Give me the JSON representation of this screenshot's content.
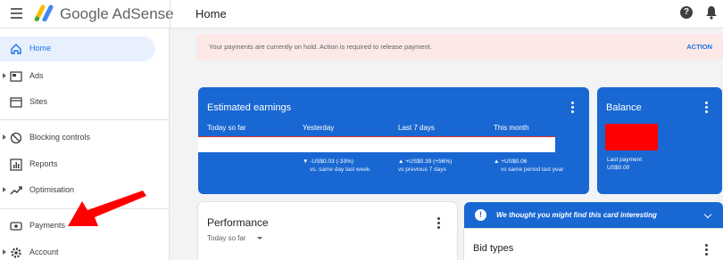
{
  "header": {
    "app_title": "Google AdSense",
    "page_title": "Home",
    "help_icon": "help-icon",
    "notification_icon": "bell-icon"
  },
  "sidebar": {
    "items": [
      {
        "label": "Home",
        "icon": "home-icon",
        "active": true
      },
      {
        "label": "Ads",
        "icon": "ads-icon",
        "expandable": true
      },
      {
        "label": "Sites",
        "icon": "sites-icon"
      },
      {
        "label": "Blocking controls",
        "icon": "block-icon",
        "expandable": true
      },
      {
        "label": "Reports",
        "icon": "reports-icon"
      },
      {
        "label": "Optimisation",
        "icon": "trending-icon",
        "expandable": true
      },
      {
        "label": "Payments",
        "icon": "payments-icon"
      },
      {
        "label": "Account",
        "icon": "gear-icon",
        "expandable": true
      }
    ]
  },
  "alert": {
    "message": "Your payments are currently on hold. Action is required to release payment.",
    "action": "ACTION"
  },
  "earnings": {
    "title": "Estimated earnings",
    "columns": [
      {
        "label": "Today so far",
        "delta": "",
        "sub": ""
      },
      {
        "label": "Yesterday",
        "delta": "▼ -US$0.03 (-33%)",
        "sub": "vs. same day last week"
      },
      {
        "label": "Last 7 days",
        "delta": "▲ +US$0.39 (+56%)",
        "sub": "vs previous 7 days"
      },
      {
        "label": "This month",
        "delta": "▲ +US$0.06",
        "sub": "vs same period last year"
      }
    ]
  },
  "balance": {
    "title": "Balance",
    "last_payment_label": "Last payment",
    "last_payment_value": "US$0.00"
  },
  "performance": {
    "title": "Performance",
    "range": "Today so far"
  },
  "suggestion": {
    "text": "We thought you might find this card interesting"
  },
  "bid_types": {
    "title": "Bid types"
  },
  "colors": {
    "primary_blue": "#1967d2",
    "alert_bg": "#fce8e6",
    "annotation_red": "#ff0000"
  }
}
